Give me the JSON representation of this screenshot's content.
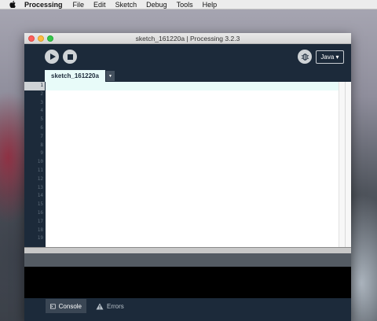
{
  "menubar": {
    "app_name": "Processing",
    "items": [
      "File",
      "Edit",
      "Sketch",
      "Debug",
      "Tools",
      "Help"
    ]
  },
  "window": {
    "title": "sketch_161220a | Processing 3.2.3"
  },
  "toolbar": {
    "mode_label": "Java ▾"
  },
  "tabs": {
    "active_tab": "sketch_161220a",
    "menu_arrow": "▼"
  },
  "editor": {
    "line_numbers": [
      "1",
      "2",
      "3",
      "4",
      "5",
      "6",
      "7",
      "8",
      "9",
      "10",
      "11",
      "12",
      "13",
      "14",
      "15",
      "16",
      "17",
      "18",
      "19"
    ],
    "active_line": 1,
    "content": ""
  },
  "footer": {
    "console_label": "Console",
    "errors_label": "Errors"
  },
  "colors": {
    "window_bg": "#1c2a3a",
    "current_line": "#e8fbf9",
    "tab_bg": "#e8fbf9"
  },
  "icons": {
    "apple": "apple-logo-icon",
    "run": "play-icon",
    "stop": "stop-icon",
    "debug": "debugger-icon",
    "console": "console-icon",
    "errors": "warning-icon"
  }
}
